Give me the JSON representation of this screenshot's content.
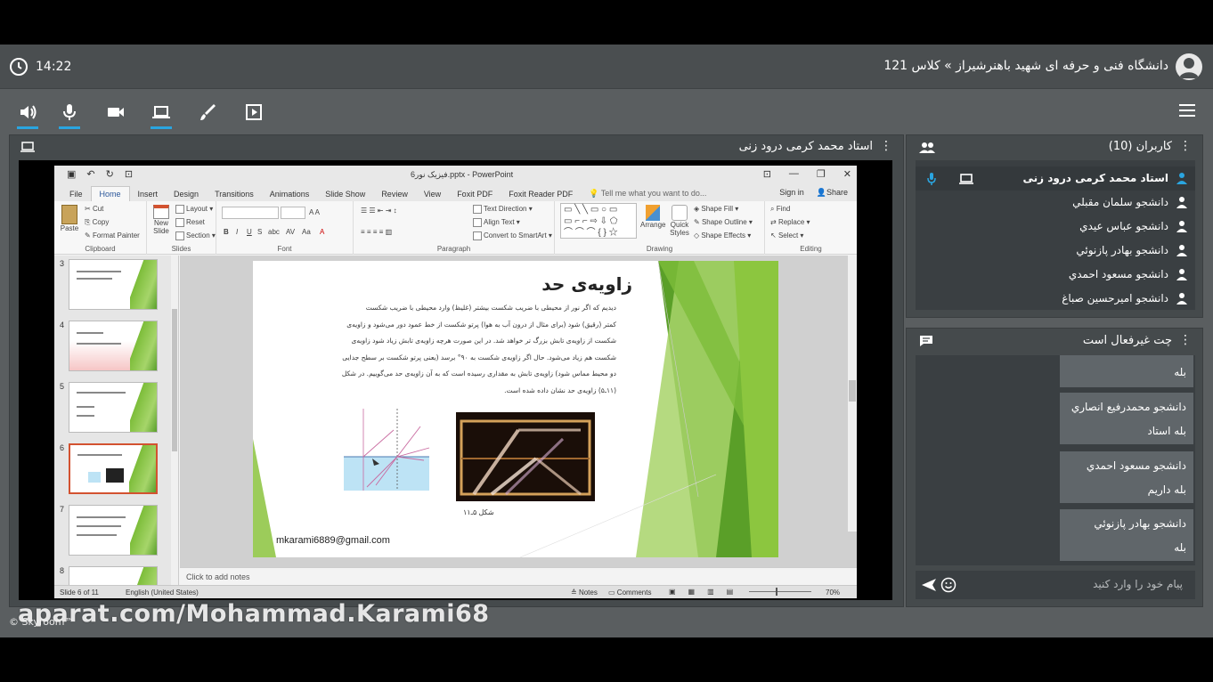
{
  "header": {
    "time": "14:22",
    "class_title": "دانشگاه فنی و حرفه ای شهید باهنرشیراز » کلاس 121"
  },
  "presenter": {
    "title": "استاد محمد کرمی درود زنی"
  },
  "powerpoint": {
    "doc_title": "فیزیک نور6.pptx - PowerPoint",
    "tabs": [
      "File",
      "Home",
      "Insert",
      "Design",
      "Transitions",
      "Animations",
      "Slide Show",
      "Review",
      "View",
      "Foxit PDF",
      "Foxit Reader PDF"
    ],
    "tell_me": "Tell me what you want to do...",
    "sign_in": "Sign in",
    "share": "Share",
    "ribbon": {
      "paste": "Paste",
      "cut": "Cut",
      "copy": "Copy",
      "format_painter": "Format Painter",
      "clipboard": "Clipboard",
      "new_slide": "New Slide",
      "layout": "Layout",
      "reset": "Reset",
      "section": "Section",
      "slides": "Slides",
      "font": "Font",
      "text_direction": "Text Direction",
      "align_text": "Align Text",
      "convert_smartart": "Convert to SmartArt",
      "paragraph": "Paragraph",
      "arrange": "Arrange",
      "quick_styles": "Quick Styles",
      "shape_fill": "Shape Fill",
      "shape_outline": "Shape Outline",
      "shape_effects": "Shape Effects",
      "drawing": "Drawing",
      "find": "Find",
      "replace": "Replace",
      "select": "Select",
      "editing": "Editing"
    },
    "thumbs": [
      "3",
      "4",
      "5",
      "6",
      "7",
      "8"
    ],
    "slide": {
      "title": "زاویه‌ی حد",
      "lines": [
        "دیدیم که اگر نور از محیطی با ضریب شکست بیشتر (غلیظ) وارد محیطی با ضریب شکست",
        "کمتر (رقیق) شود (برای مثال از درون آب به هوا) پرتو شکست از خط عمود دور می‌شود و زاویه‌ی",
        "شکست از زاویه‌ی تابش بزرگ تر خواهد شد. در این صورت هرچه زاویه‌ی تابش زیاد شود زاویه‌ی",
        "شکست هم زیاد می‌شود. حال اگر زاویه‌ی شکست به ۹۰° برسد (یعنی پرتو شکست بر سطح جدایی",
        "دو محیط مماس شود) زاویه‌ی تابش به مقداری رسیده است که به آن زاویه‌ی حد می‌گوییم. در شکل",
        "(۱۱ـ۵) زاویه‌ی حد نشان داده شده است."
      ],
      "figure_caption": "شکل ۵ـ۱۱",
      "email": "mkarami6889@gmail.com"
    },
    "notes_placeholder": "Click to add notes",
    "status": {
      "slide_of": "Slide 6 of 11",
      "language": "English (United States)",
      "notes": "Notes",
      "comments": "Comments",
      "zoom": "70%"
    }
  },
  "users": {
    "title": "کاربران (10)",
    "list": [
      "استاد محمد کرمی درود زنی",
      "دانشجو سلمان مقبلي",
      "دانشجو عباس عيدي",
      "دانشجو بهادر پازنوئي",
      "دانشجو مسعود احمدي",
      "دانشجو اميرحسين صباغ"
    ]
  },
  "chat": {
    "title": "چت غیرفعال است",
    "messages": [
      {
        "sender": "",
        "text": "بله"
      },
      {
        "sender": "دانشجو محمدرفيع انصاري",
        "text": "بله استاد"
      },
      {
        "sender": "دانشجو مسعود احمدي",
        "text": "بله داريم"
      },
      {
        "sender": "دانشجو بهادر پازنوئي",
        "text": "بله"
      }
    ],
    "input_placeholder": "پیام خود را وارد کنید"
  },
  "watermark": "aparat.com/Mohammad.Karami68",
  "brand": "© Skyroom™",
  "colors": {
    "accent": "#2aa5e0",
    "slide_green": "#7dbd3a"
  }
}
